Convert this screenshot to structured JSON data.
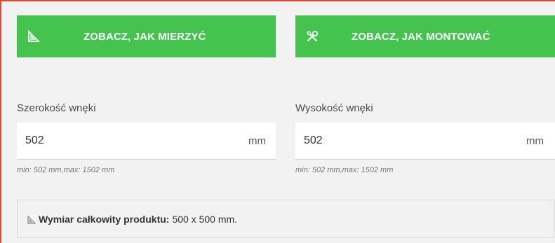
{
  "buttons": {
    "measure": {
      "label": "ZOBACZ, JAK MIERZYĆ",
      "icon": "triangle-ruler-icon"
    },
    "mount": {
      "label": "ZOBACZ, JAK MONTOWAĆ",
      "icon": "tools-icon"
    }
  },
  "fields": {
    "width": {
      "label": "Szerokość wnęki",
      "value": "502",
      "unit": "mm",
      "hint": "min: 502 mm,max: 1502 mm"
    },
    "height": {
      "label": "Wysokość wnęki",
      "value": "502",
      "unit": "mm",
      "hint": "min: 502 mm,max: 1502 mm"
    }
  },
  "info": {
    "icon": "triangle-ruler-icon",
    "label": "Wymiar całkowity produktu:",
    "value": "500 x 500 mm."
  },
  "colors": {
    "accent_green": "#45c34f",
    "frame_red": "#e8442f"
  }
}
